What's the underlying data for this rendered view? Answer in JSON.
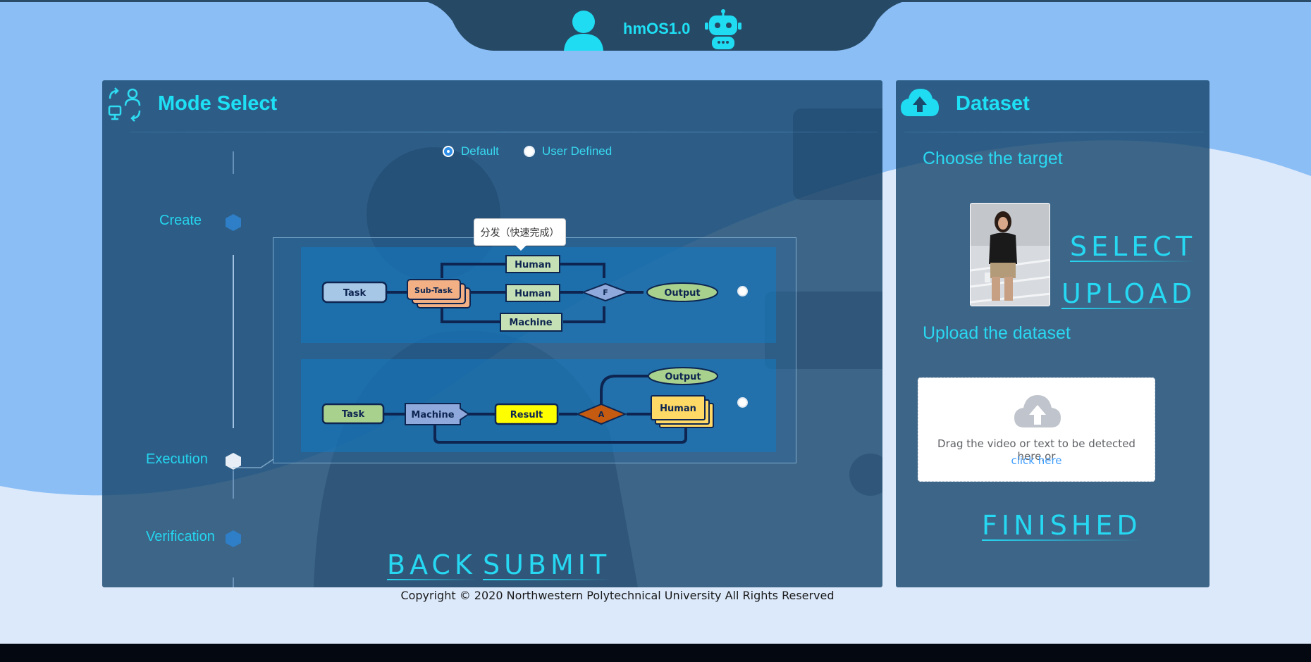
{
  "header": {
    "title": "hmOS1.0",
    "user_icon": "user-icon",
    "robot_icon": "robot-icon"
  },
  "mode_panel": {
    "title": "Mode Select",
    "icon": "mode-switch-icon",
    "radios": [
      {
        "label": "Default",
        "checked": true
      },
      {
        "label": "User Defined",
        "checked": false
      }
    ],
    "steps": [
      "Create",
      "Execution",
      "Verification"
    ],
    "tooltip": "分发（快速完成）",
    "diagram_top": {
      "task": "Task",
      "subtask": "Sub-Task",
      "human1": "Human",
      "human2": "Human",
      "machine": "Machine",
      "fusion": "F",
      "output": "Output"
    },
    "diagram_bottom": {
      "task": "Task",
      "machine": "Machine",
      "result": "Result",
      "assess": "A",
      "human": "Human",
      "output": "Output"
    },
    "back_label": "BACK",
    "submit_label": "SUBMIT"
  },
  "dataset_panel": {
    "title": "Dataset",
    "icon": "cloud-upload-icon",
    "choose_target": "Choose the target",
    "select_label": "SELECT",
    "upload_label": "UPLOAD",
    "upload_dataset": "Upload the dataset",
    "drop_text": "Drag the video or text to be detected here,or",
    "drop_link": "click here",
    "finished_label": "FINISHED"
  },
  "footer": {
    "copyright": "Copyright © 2020 Northwestern Polytechnical University All Rights Reserved"
  },
  "colors": {
    "accent": "#1ee0f5",
    "panel": "#19486e",
    "background": "#8bbef5"
  }
}
